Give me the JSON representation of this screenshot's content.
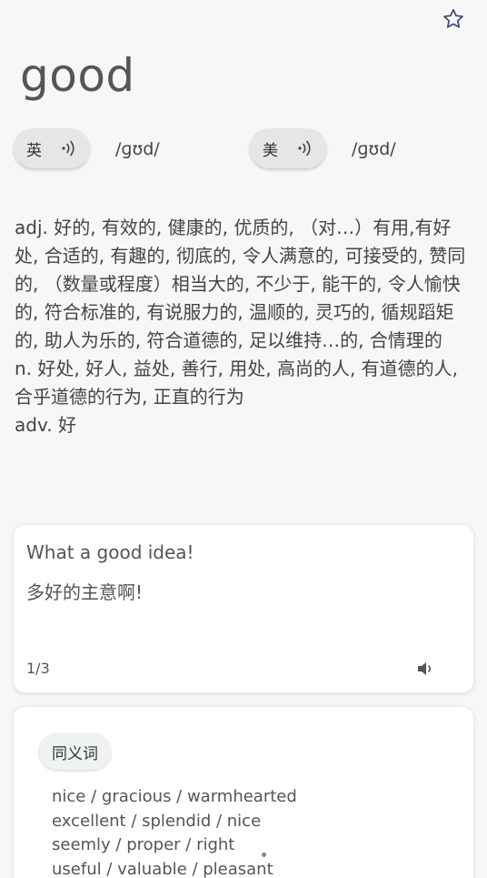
{
  "word": "good",
  "pronunciation": [
    {
      "lang": "英",
      "ipa": "/ɡʊd/"
    },
    {
      "lang": "美",
      "ipa": "/ɡʊd/"
    }
  ],
  "definitions": [
    "adj. 好的, 有效的, 健康的, 优质的, （对…）有用,有好处, 合适的, 有趣的, 彻底的, 令人满意的, 可接受的, 赞同的, （数量或程度）相当大的, 不少于, 能干的, 令人愉快的, 符合标准的, 有说服力的, 温顺的, 灵巧的, 循规蹈矩的, 助人为乐的, 符合道德的, 足以维持…的, 合情理的",
    "n. 好处, 好人, 益处, 善行, 用处, 高尚的人, 有道德的人, 合乎道德的行为, 正直的行为",
    "adv. 好"
  ],
  "example": {
    "en": "What a good idea!",
    "zh": "多好的主意啊!",
    "page": "1/3"
  },
  "synonyms": {
    "label": "同义词",
    "lines": [
      "nice / gracious / warmhearted",
      "excellent / splendid / nice",
      "seemly / proper / right",
      "useful / valuable / pleasant"
    ]
  },
  "icons": {
    "favorite": "star-outline-icon",
    "audio": "speaker-wave-icon",
    "audio_example": "speaker-icon"
  },
  "colors": {
    "star": "#3b4a7a",
    "chip_bg": "#e6e6e6",
    "syn_chip_bg": "#eef2f3"
  }
}
